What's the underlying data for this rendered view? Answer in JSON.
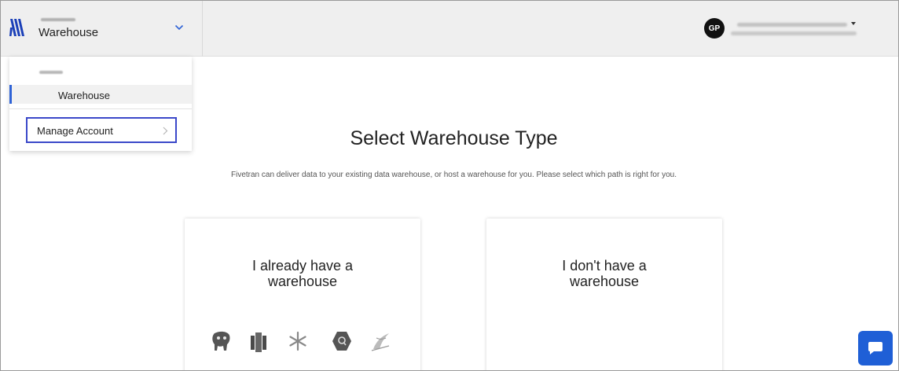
{
  "header": {
    "account_name": "Warehouse",
    "avatar_initials": "GP"
  },
  "dropdown": {
    "selected_item": "Warehouse",
    "manage_account_label": "Manage Account"
  },
  "main": {
    "title": "Select Warehouse Type",
    "subtitle": "Fivetran can deliver data to your existing data warehouse, or host a warehouse for you. Please select which path is right for you.",
    "cards": [
      {
        "label_line1": "I already have a",
        "label_line2": "warehouse"
      },
      {
        "label_line1": "I don't have a",
        "label_line2": "warehouse"
      }
    ],
    "warehouse_icons": [
      "postgres-icon",
      "redshift-icon",
      "snowflake-icon",
      "bigquery-icon",
      "sql-server-icon"
    ]
  },
  "colors": {
    "accent": "#2f63d6",
    "focus_border": "#3b48c9",
    "chat_button": "#1f5fd6",
    "header_bg": "#efefef"
  },
  "icons": {
    "logo": "fivetran-logo-icon",
    "account_toggle": "chevron-down-icon",
    "user_menu": "caret-down-icon",
    "manage_account": "chevron-right-icon",
    "chat": "chat-bubble-icon"
  }
}
